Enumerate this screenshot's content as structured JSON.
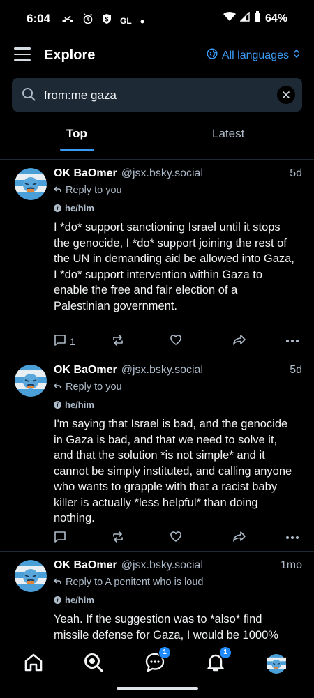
{
  "status_bar": {
    "time": "6:04",
    "glyph_gl": "GL",
    "battery_text": "64%"
  },
  "header": {
    "title": "Explore",
    "language_label": "All languages"
  },
  "search": {
    "value": "from:me gaza"
  },
  "tabs": [
    {
      "label": "Top"
    },
    {
      "label": "Latest"
    }
  ],
  "posts": [
    {
      "display_name": "OK BaOmer",
      "handle": "@jsx.bsky.social",
      "time": "5d",
      "reply_label": "Reply to you",
      "pronouns": "he/him",
      "text": "I *do* support sanctioning Israel until it stops the genocide, I *do* support joining the rest of the UN in demanding aid be allowed into Gaza, I *do* support intervention within Gaza to enable the free and fair election of a Palestinian government.",
      "reply_count": "1"
    },
    {
      "display_name": "OK BaOmer",
      "handle": "@jsx.bsky.social",
      "time": "5d",
      "reply_label": "Reply to you",
      "pronouns": "he/him",
      "text": "I'm saying that Israel is bad, and the genocide in Gaza is bad, and that we need to solve it, and that the solution *is not simple* and it cannot be simply instituted, and calling anyone who wants to grapple with that a racist baby killer is actually *less helpful* than doing nothing.",
      "reply_count": ""
    },
    {
      "display_name": "OK BaOmer",
      "handle": "@jsx.bsky.social",
      "time": "1mo",
      "reply_label": "Reply to A penitent who is loud",
      "pronouns": "he/him",
      "text": "Yeah. If the suggestion was to *also* find missile defense for Gaza, I would be 1000%",
      "reply_count": ""
    }
  ],
  "bottom_nav": {
    "chat_badge": "1",
    "notifications_badge": "1"
  },
  "colors": {
    "accent": "#3b9af5",
    "badge": "#208bfe",
    "muted": "#aebbc9"
  }
}
